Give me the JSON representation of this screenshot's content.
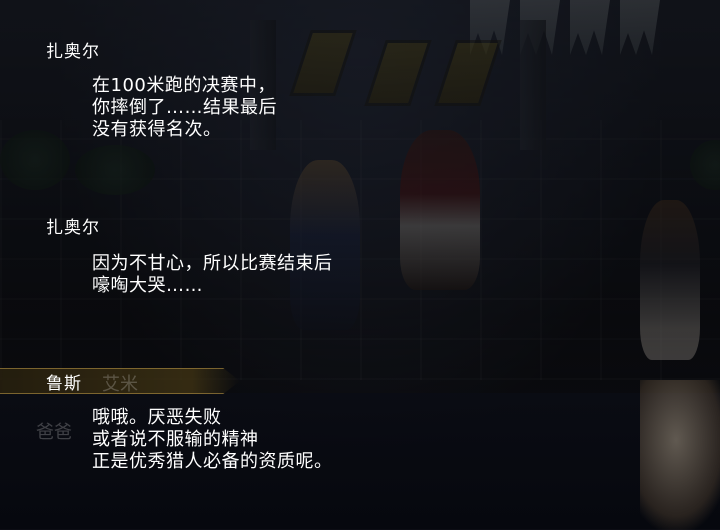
{
  "dialogue": [
    {
      "speaker": "扎奥尔",
      "lines": [
        "在100米跑的决赛中，",
        "你摔倒了……结果最后",
        "没有获得名次。"
      ]
    },
    {
      "speaker": "扎奥尔",
      "lines": [
        "因为不甘心，所以比赛结束后",
        "嚎啕大哭……"
      ]
    },
    {
      "speaker": "鲁斯",
      "lines": [
        "哦哦。厌恶失败",
        "或者说不服输的精神",
        "正是优秀猎人必备的资质呢。"
      ]
    }
  ],
  "background_text": {
    "nameplate_ghost": "艾米",
    "ghost_left": "爸爸"
  },
  "colors": {
    "text": "#ffffff",
    "nameplate_gold": "#a0823c",
    "bg": "#0c0d14"
  }
}
